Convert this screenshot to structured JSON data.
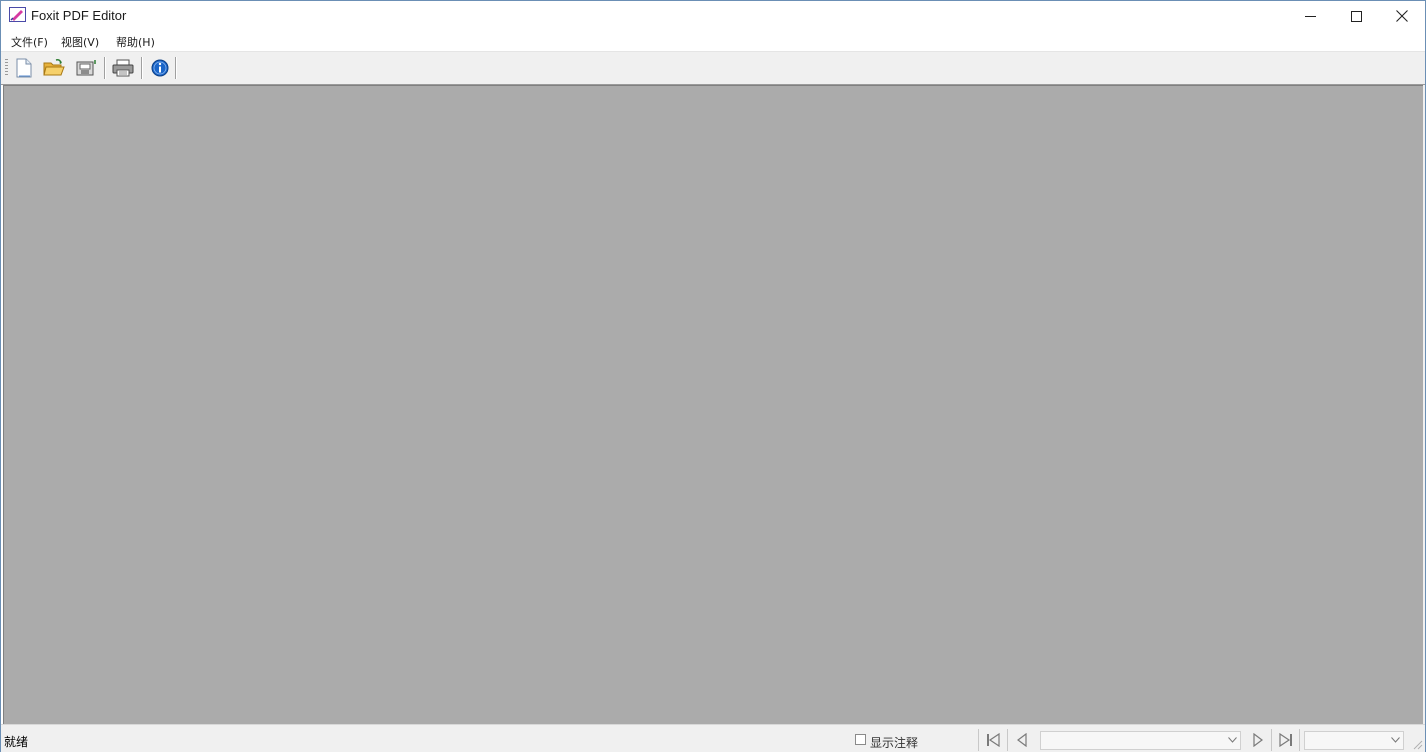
{
  "window": {
    "title": "Foxit PDF Editor"
  },
  "menu": {
    "items": [
      {
        "id": "file",
        "label": "文件(F)"
      },
      {
        "id": "view",
        "label": "视图(V)"
      },
      {
        "id": "help",
        "label": "帮助(H)"
      }
    ]
  },
  "toolbar": {
    "buttons": [
      {
        "id": "new",
        "icon": "new-document-icon"
      },
      {
        "id": "open",
        "icon": "open-folder-icon"
      },
      {
        "id": "save",
        "icon": "save-icon"
      },
      {
        "id": "print",
        "icon": "printer-icon"
      },
      {
        "id": "about",
        "icon": "info-icon"
      }
    ]
  },
  "status": {
    "text": "就绪",
    "show_annotations_label": "显示注释",
    "show_annotations_checked": false,
    "page_combo_value": "",
    "zoom_combo_value": ""
  },
  "colors": {
    "workspace": "#ababab",
    "toolbar": "#f0f0f0",
    "accent_blue": "#1b66c9"
  }
}
